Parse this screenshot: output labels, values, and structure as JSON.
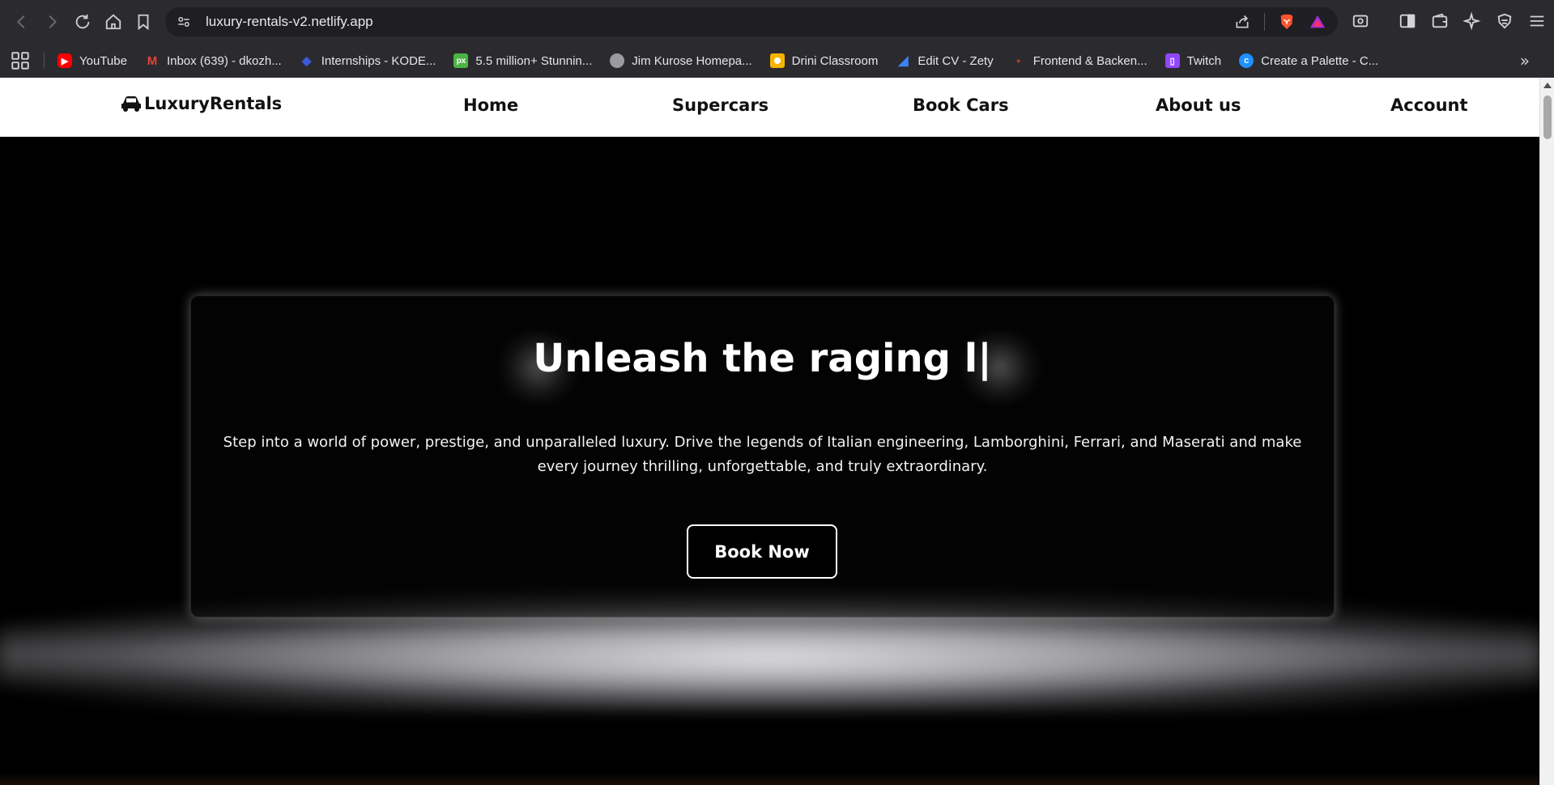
{
  "browser": {
    "url": "luxury-rentals-v2.netlify.app",
    "bookmarks": [
      {
        "label": "YouTube",
        "icon": "youtube-icon",
        "color": "#ff0000"
      },
      {
        "label": "Inbox (639) - dkozh...",
        "icon": "gmail-icon",
        "color": "#ea4335"
      },
      {
        "label": "Internships - KODE...",
        "icon": "kode-icon",
        "color": "#2a3b8f"
      },
      {
        "label": "5.5 million+ Stunnin...",
        "icon": "pixabay-icon",
        "color": "#4bb543"
      },
      {
        "label": "Jim Kurose Homepa...",
        "icon": "globe-icon",
        "color": "#9a9aa0"
      },
      {
        "label": "Drini Classroom",
        "icon": "classroom-icon",
        "color": "#f4b400"
      },
      {
        "label": "Edit CV - Zety",
        "icon": "zety-icon",
        "color": "#3b82f6"
      },
      {
        "label": "Frontend & Backen...",
        "icon": "roadmap-icon",
        "color": "#c0392b"
      },
      {
        "label": "Twitch",
        "icon": "twitch-icon",
        "color": "#9146ff"
      },
      {
        "label": "Create a Palette - C...",
        "icon": "coolors-icon",
        "color": "#1e90ff"
      }
    ]
  },
  "site": {
    "logo": "LuxuryRentals",
    "nav": [
      "Home",
      "Supercars",
      "Book Cars",
      "About us",
      "Account"
    ]
  },
  "hero": {
    "title": "Unleash the raging l|",
    "text": "Step into a world of power, prestige, and unparalleled luxury. Drive the legends of Italian engineering, Lamborghini, Ferrari, and Maserati and make every journey thrilling, unforgettable, and truly extraordinary.",
    "button": "Book Now"
  }
}
